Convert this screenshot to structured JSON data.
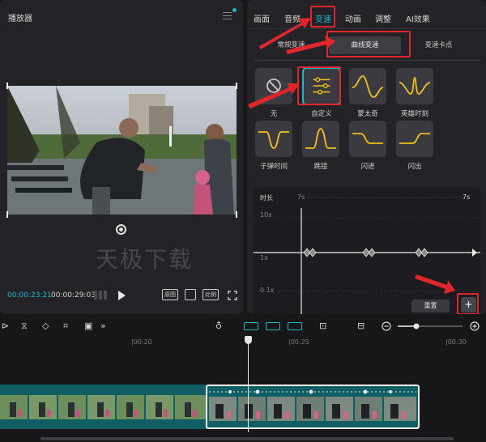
{
  "player": {
    "title": "播放器",
    "watermark": "天极下载",
    "time_current": "00:00:23:21",
    "time_total": "00:00:29:03",
    "btn_full": "原图",
    "btn_ratio": "比例"
  },
  "props": {
    "tabs": [
      "画面",
      "音频",
      "变速",
      "动画",
      "调整",
      "AI效果"
    ],
    "active_tab": "变速",
    "speed_modes": [
      "常规变速",
      "曲线变速",
      "变速卡点"
    ],
    "active_mode": "曲线变速",
    "presets": [
      "无",
      "自定义",
      "蒙太奇",
      "英雄时刻",
      "子弹时间",
      "跳接",
      "闪进",
      "闪出"
    ],
    "selected_preset": "自定义",
    "editor": {
      "duration_label": "时长",
      "duration_start": "7s",
      "duration_end": "7s",
      "y_labels": [
        "10x",
        "1x",
        "0.1x"
      ],
      "reset_label": "重置",
      "add_label": "+"
    }
  },
  "timeline": {
    "ticks": [
      "|00:20",
      "|00:25",
      "|00:30"
    ]
  },
  "colors": {
    "accent": "#1fb6c6",
    "highlight": "#e0262b",
    "curve": "#f2c01c",
    "panel": "#232327",
    "clip": "#0f5e63"
  },
  "icons": [
    "menu-icon",
    "rotate-icon",
    "play-icon",
    "fullscreen-icon",
    "mic-icon",
    "zoom-out-icon",
    "zoom-in-icon",
    "plus-icon"
  ]
}
